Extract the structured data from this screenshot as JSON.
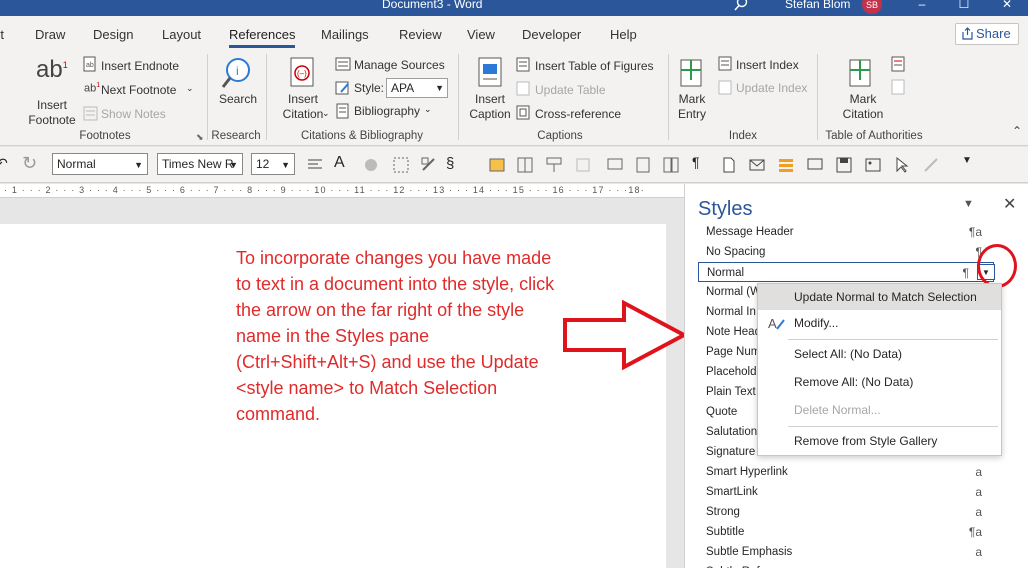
{
  "titlebar": {
    "title": "Document3  -  Word",
    "user": "Stefan Blom",
    "avatar_initials": "SB",
    "minimize": "–",
    "restore": "☐",
    "close": "✕"
  },
  "tabs": [
    {
      "label": "rt"
    },
    {
      "label": "Draw"
    },
    {
      "label": "Design"
    },
    {
      "label": "Layout"
    },
    {
      "label": "References"
    },
    {
      "label": "Mailings"
    },
    {
      "label": "Review"
    },
    {
      "label": "View"
    },
    {
      "label": "Developer"
    },
    {
      "label": "Help"
    }
  ],
  "share_label": "Share",
  "ribbon": {
    "insert_footnote": "Insert\nFootnote",
    "insert_endnote": "Insert Endnote",
    "next_footnote": "Next Footnote",
    "show_notes": "Show Notes",
    "footnotes_group": "Footnotes",
    "search": "Search",
    "research_group": "Research",
    "insert_citation": "Insert\nCitation",
    "manage_sources": "Manage Sources",
    "style_label": "Style:",
    "style_value": "APA",
    "bibliography": "Bibliography",
    "citations_group": "Citations & Bibliography",
    "insert_caption": "Insert\nCaption",
    "insert_table_of_figures": "Insert Table of Figures",
    "update_table": "Update Table",
    "cross_reference": "Cross-reference",
    "captions_group": "Captions",
    "mark_entry": "Mark\nEntry",
    "insert_index": "Insert Index",
    "update_index": "Update Index",
    "index_group": "Index",
    "mark_citation": "Mark\nCitation",
    "toa_group": "Table of Authorities"
  },
  "qat": {
    "style": "Normal",
    "font": "Times New R",
    "size": "12"
  },
  "ruler": {
    "marks": "· 1 · · · 2 · · · 3 · · · 4 · · · 5 · · · 6 · · · 7 · · · 8 · · · 9 · · · 10 · · · 11 · · · 12 · · · 13 · · · 14 · · · 15 · · · 16 · · · 17 · · ·18·"
  },
  "instruction": "To incorporate changes you have made to text in a document into the style, click the arrow on the far right of the style name in the Styles pane (Ctrl+Shift+Alt+S) and use the Update <style name> to Match Selection command.",
  "styles_pane": {
    "title": "Styles",
    "rows": [
      {
        "name": "Message Header",
        "mark": "¶a"
      },
      {
        "name": "No Spacing",
        "mark": "¶"
      },
      {
        "name": "Normal",
        "mark": "¶"
      },
      {
        "name": "Normal (W",
        "mark": ""
      },
      {
        "name": "Normal In",
        "mark": ""
      },
      {
        "name": "Note Head",
        "mark": ""
      },
      {
        "name": "Page Num",
        "mark": ""
      },
      {
        "name": "Placehold",
        "mark": ""
      },
      {
        "name": "Plain Text",
        "mark": ""
      },
      {
        "name": "Quote",
        "mark": ""
      },
      {
        "name": "Salutation",
        "mark": ""
      },
      {
        "name": "Signature",
        "mark": ""
      },
      {
        "name": "Smart Hyperlink",
        "mark": "a"
      },
      {
        "name": "SmartLink",
        "mark": "a"
      },
      {
        "name": "Strong",
        "mark": "a"
      },
      {
        "name": "Subtitle",
        "mark": "¶a"
      },
      {
        "name": "Subtle Emphasis",
        "mark": "a"
      },
      {
        "name": "Subtle Reference",
        "mark": "a"
      }
    ]
  },
  "context_menu": {
    "update": "Update Normal to Match Selection",
    "modify": "Modify...",
    "select_all": "Select All: (No Data)",
    "remove_all": "Remove All: (No Data)",
    "delete": "Delete Normal...",
    "remove_gallery": "Remove from Style Gallery"
  },
  "colors": {
    "word_blue": "#2b579a",
    "annotation_red": "#e02b2b",
    "highlight": "#e1dfdd"
  }
}
